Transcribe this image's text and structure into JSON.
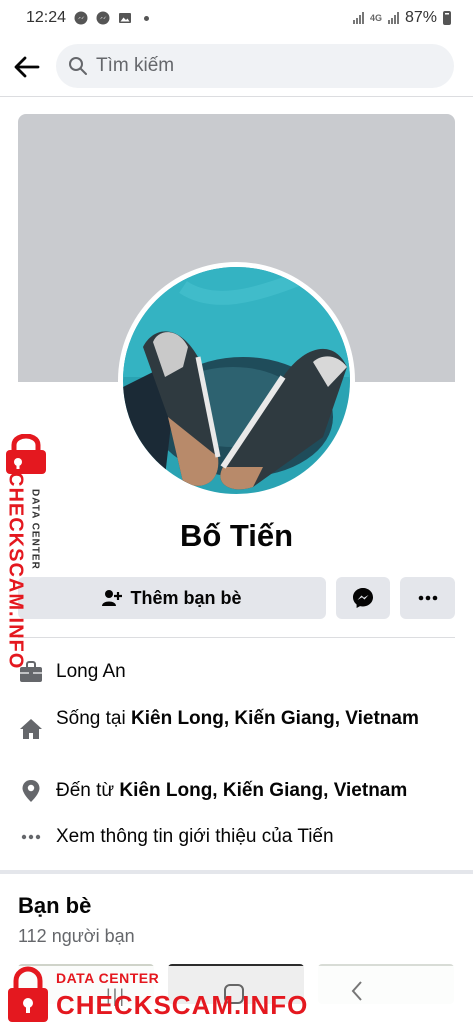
{
  "status_bar": {
    "time": "12:24",
    "network": "4G",
    "battery": "87%"
  },
  "search": {
    "placeholder": "Tìm kiếm"
  },
  "profile": {
    "name": "Bố Tiến"
  },
  "actions": {
    "add_friend_label": "Thêm bạn bè"
  },
  "info": {
    "work": "Long An",
    "lives_prefix": "Sống tại ",
    "lives_place": "Kiên Long, Kiến Giang, Vietnam",
    "from_prefix": "Đến từ ",
    "from_place": "Kiên Long, Kiến Giang, Vietnam",
    "about": "Xem thông tin giới thiệu của Tiến"
  },
  "friends": {
    "title": "Bạn bè",
    "count": "112 người bạn"
  },
  "watermark": {
    "small": "DATA CENTER",
    "big": "CHECKSCAM.INFO"
  },
  "colors": {
    "accent": "#1877f2",
    "watermark_red": "#e4181f",
    "button_bg": "#e4e6eb",
    "cover": "#c9cbcf"
  }
}
